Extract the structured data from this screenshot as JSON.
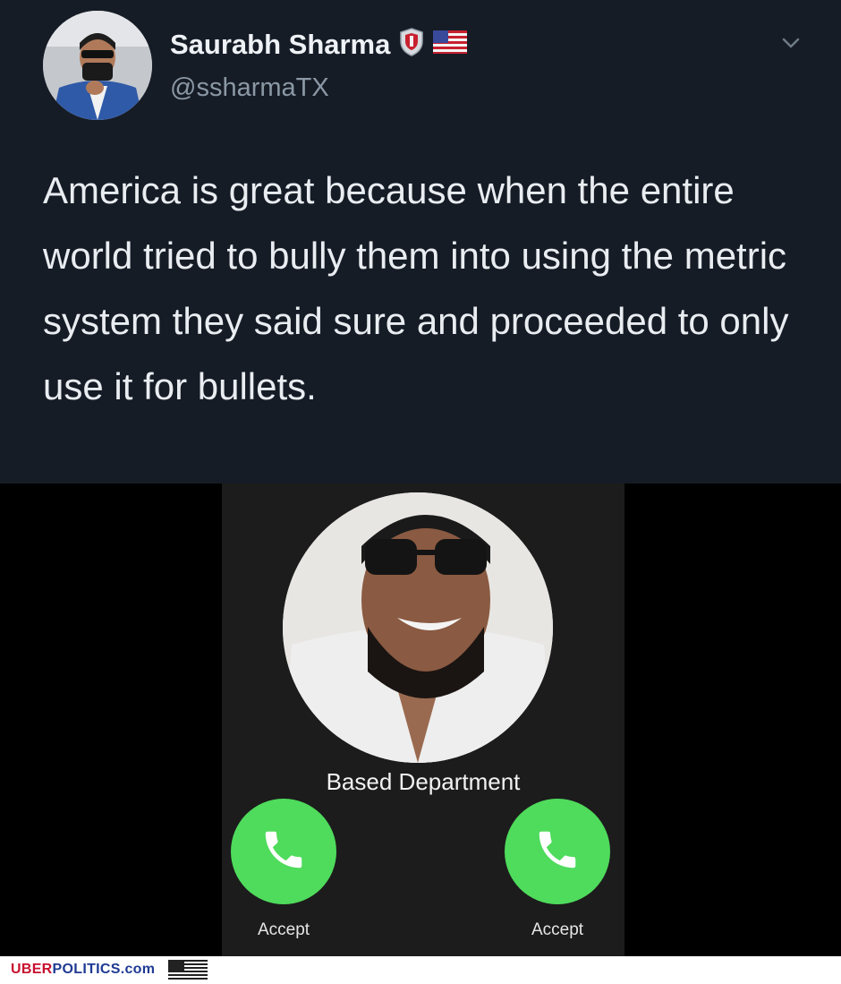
{
  "tweet": {
    "display_name": "Saurabh Sharma",
    "handle": "@ssharmaTX",
    "text": "America is great because when the entire world tried to bully them into using the metric system they said sure and proceeded to only use it for bullets.",
    "icons": [
      "shield-badge-icon",
      "us-flag-icon",
      "chevron-down-icon"
    ]
  },
  "call_screen": {
    "caller_name": "Based Department",
    "left_button_label": "Accept",
    "right_button_label": "Accept",
    "button_color": "#4fdb5c",
    "icons": [
      "phone-icon"
    ]
  },
  "footer": {
    "brand_part1": "UBER",
    "brand_part2": "POLITICS",
    "brand_part3": ".com",
    "colors": {
      "red": "#c8102e",
      "blue": "#1f3a93"
    },
    "icons": [
      "us-flag-icon"
    ]
  },
  "colors": {
    "tweet_background": "#161c26",
    "text_primary": "#e9edf1",
    "text_secondary": "#8b98a5"
  }
}
